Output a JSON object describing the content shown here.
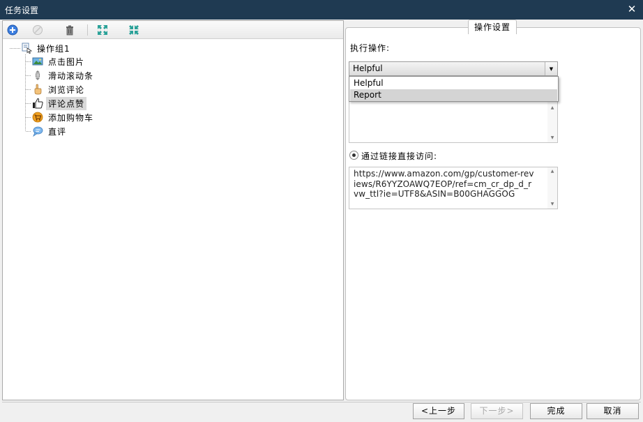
{
  "window": {
    "title": "任务设置",
    "close_glyph": "✕"
  },
  "toolbar": {
    "buttons": [
      {
        "name": "add",
        "icon": "add-circle-icon",
        "enabled": true
      },
      {
        "name": "disable",
        "icon": "disabled-circle-icon",
        "enabled": false
      },
      {
        "name": "delete",
        "icon": "trash-icon",
        "enabled": true
      },
      {
        "name": "expand-all",
        "icon": "expand-arrows-icon",
        "enabled": true
      },
      {
        "name": "collapse-all",
        "icon": "collapse-arrows-icon",
        "enabled": true
      }
    ]
  },
  "tree": {
    "root": {
      "label": "操作组1",
      "icon": "action-group-icon"
    },
    "children": [
      {
        "label": "点击图片",
        "icon": "image-click-icon"
      },
      {
        "label": "滑动滚动条",
        "icon": "scrollbar-icon"
      },
      {
        "label": "浏览评论",
        "icon": "hand-browse-icon"
      },
      {
        "label": "评论点赞",
        "icon": "thumbs-up-icon",
        "selected": true
      },
      {
        "label": "添加购物车",
        "icon": "cart-icon"
      },
      {
        "label": "直评",
        "icon": "comment-bubble-icon"
      }
    ]
  },
  "settings": {
    "group_title": "操作设置",
    "action_label": "执行操作:",
    "action_selected": "Helpful",
    "action_options": [
      "Helpful",
      "Report"
    ],
    "action_hover_option": "Report",
    "link_radio_label": "通过链接直接访问:",
    "link_radio_checked": true,
    "url_value": "https://www.amazon.com/gp/customer-reviews/R6YYZOAWQ7EOP/ref=cm_cr_dp_d_rvw_ttl?ie=UTF8&ASIN=B00GHAGGOG"
  },
  "footer": {
    "prev_label": "<上一步",
    "next_label": "下一步>",
    "finish_label": "完成",
    "cancel_label": "取消"
  },
  "colors": {
    "titlebar": "#1f3a52",
    "add_icon": "#2e6fd1",
    "expand_icon": "#2aa198"
  }
}
